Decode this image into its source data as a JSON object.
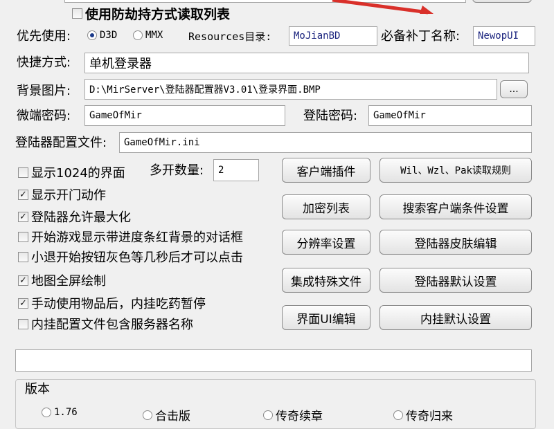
{
  "top": {
    "readlist_label": "使用防劫持方式读取列表",
    "readlist_checked": false
  },
  "priority": {
    "label": "优先使用:",
    "options": [
      {
        "label": "D3D",
        "selected": true
      },
      {
        "label": "MMX",
        "selected": false
      }
    ]
  },
  "resources": {
    "label": "Resources目录:",
    "value": "MoJianBD"
  },
  "patch": {
    "label": "必备补丁名称:",
    "value": "NewopUI"
  },
  "shortcut": {
    "label": "快捷方式:",
    "value": "单机登录器"
  },
  "background": {
    "label": "背景图片:",
    "value": "D:\\MirServer\\登陆器配置器V3.01\\登录界面.BMP",
    "browse_label": "..."
  },
  "client_pwd": {
    "label": "微端密码:",
    "value": "GameOfMir"
  },
  "login_pwd": {
    "label": "登陆密码:",
    "value": "GameOfMir"
  },
  "config_file": {
    "label": "登陆器配置文件:",
    "value": "GameOfMir.ini"
  },
  "multi": {
    "label": "多开数量:",
    "value": "2"
  },
  "options": [
    {
      "label": "显示1024的界面",
      "checked": false
    },
    {
      "label": "显示开门动作",
      "checked": true
    },
    {
      "label": "登陆器允许最大化",
      "checked": true
    },
    {
      "label": "开始游戏显示带进度条红背景的对话框",
      "checked": false
    },
    {
      "label": "小退开始按钮灰色等几秒后才可以点击",
      "checked": false
    },
    {
      "label": "地图全屏绘制",
      "checked": true
    },
    {
      "label": "手动使用物品后，内挂吃药暂停",
      "checked": true
    },
    {
      "label": "内挂配置文件包含服务器名称",
      "checked": false
    }
  ],
  "buttons": {
    "client_plugin": "客户端插件",
    "wil_rules": "Wil、Wzl、Pak读取规则",
    "encrypt_list": "加密列表",
    "search_client": "搜索客户端条件设置",
    "resolution": "分辨率设置",
    "skin_edit": "登陆器皮肤编辑",
    "integrate": "集成特殊文件",
    "default_settings": "登陆器默认设置",
    "ui_edit": "界面UI编辑",
    "plugin_default": "内挂默认设置"
  },
  "status_value": "",
  "version": {
    "title": "版本",
    "options": [
      "1.76",
      "合击版",
      "传奇续章",
      "传奇归来"
    ]
  },
  "colors": {
    "accent_arrow": "#d9302a",
    "button_border": "#8a8a8a",
    "field_border": "#a6a6a6"
  }
}
